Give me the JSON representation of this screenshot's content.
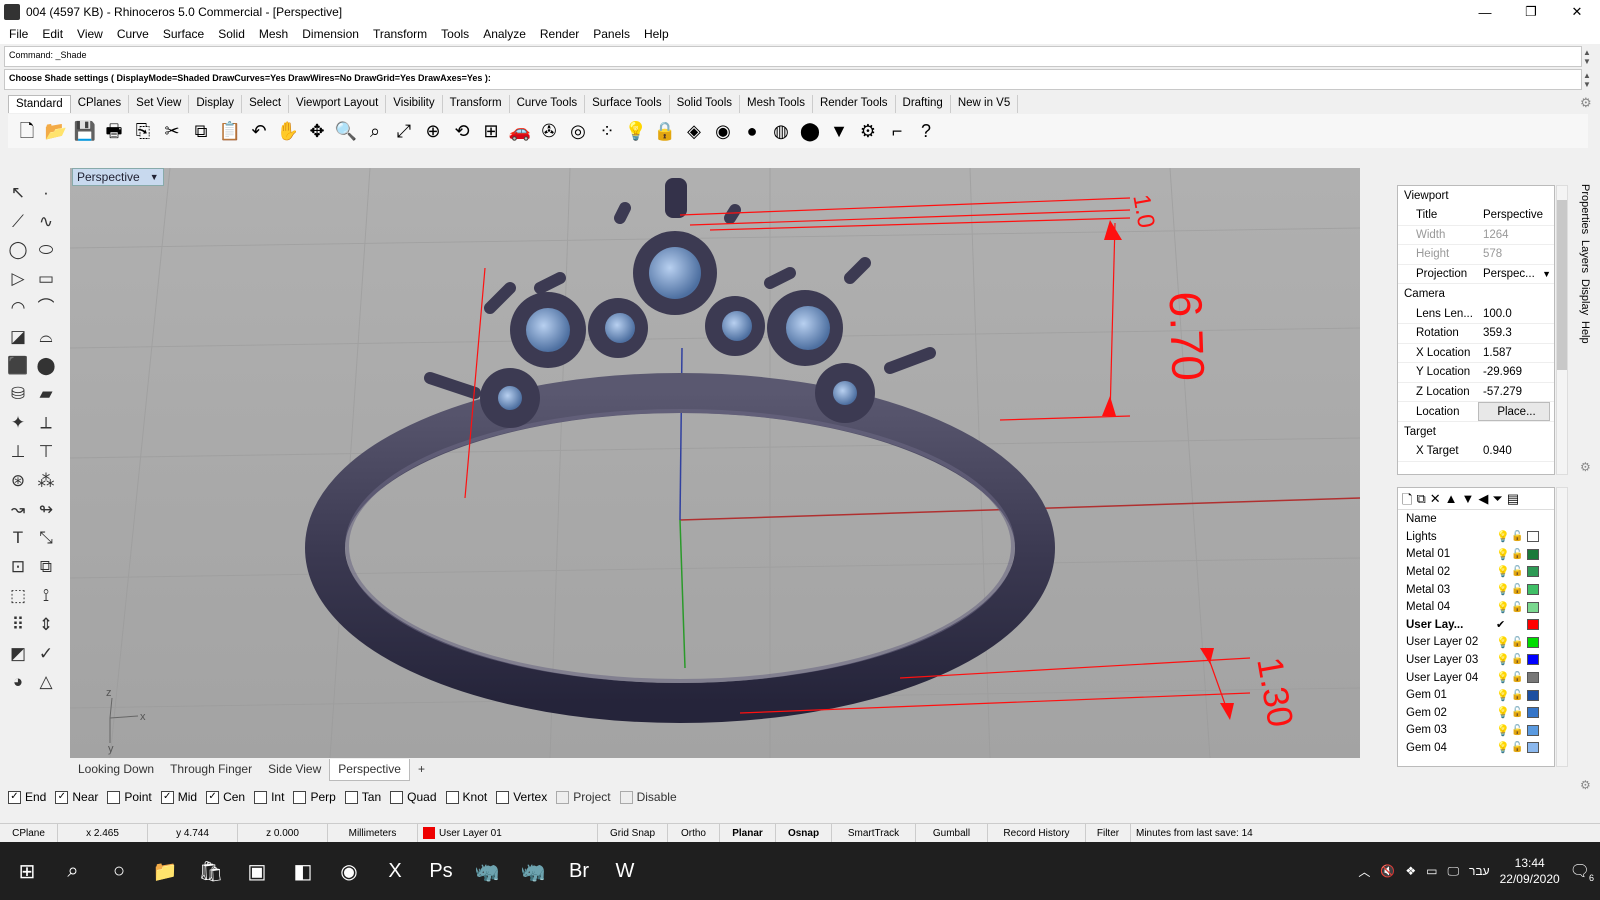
{
  "window": {
    "title": "004 (4597 KB) - Rhinoceros 5.0 Commercial - [Perspective]",
    "minimize": "—",
    "restore": "❐",
    "close": "✕"
  },
  "menu": [
    "File",
    "Edit",
    "View",
    "Curve",
    "Surface",
    "Solid",
    "Mesh",
    "Dimension",
    "Transform",
    "Tools",
    "Analyze",
    "Render",
    "Panels",
    "Help"
  ],
  "command": {
    "history": "Command: _Shade",
    "prompt": "Choose Shade settings ( DisplayMode=Shaded  DrawCurves=Yes  DrawWires=No  DrawGrid=Yes  DrawAxes=Yes ):"
  },
  "toolbar_tabs": [
    "Standard",
    "CPlanes",
    "Set View",
    "Display",
    "Select",
    "Viewport Layout",
    "Visibility",
    "Transform",
    "Curve Tools",
    "Surface Tools",
    "Solid Tools",
    "Mesh Tools",
    "Render Tools",
    "Drafting",
    "New in V5"
  ],
  "toolbar_icons": [
    {
      "name": "new-icon",
      "glyph": "🗋"
    },
    {
      "name": "open-icon",
      "glyph": "📂"
    },
    {
      "name": "save-icon",
      "glyph": "💾"
    },
    {
      "name": "print-icon",
      "glyph": "🖶"
    },
    {
      "name": "import-icon",
      "glyph": "⎘"
    },
    {
      "name": "cut-icon",
      "glyph": "✂"
    },
    {
      "name": "copy-icon",
      "glyph": "⧉"
    },
    {
      "name": "paste-icon",
      "glyph": "📋"
    },
    {
      "name": "undo-icon",
      "glyph": "↶"
    },
    {
      "name": "pan-icon",
      "glyph": "✋"
    },
    {
      "name": "move-view-icon",
      "glyph": "✥"
    },
    {
      "name": "zoom-icon",
      "glyph": "🔍"
    },
    {
      "name": "zoom-window-icon",
      "glyph": "⌕"
    },
    {
      "name": "zoom-extents-icon",
      "glyph": "⤢"
    },
    {
      "name": "zoom-selected-icon",
      "glyph": "⊕"
    },
    {
      "name": "rotate-view-icon",
      "glyph": "⟲"
    },
    {
      "name": "viewport-layout-icon",
      "glyph": "⊞"
    },
    {
      "name": "car-icon",
      "glyph": "🚗"
    },
    {
      "name": "gumball-icon",
      "glyph": "✇"
    },
    {
      "name": "circle-select-icon",
      "glyph": "◎"
    },
    {
      "name": "points-icon",
      "glyph": "⁘"
    },
    {
      "name": "light-icon",
      "glyph": "💡"
    },
    {
      "name": "lock-icon",
      "glyph": "🔒"
    },
    {
      "name": "layer-icon",
      "glyph": "◈"
    },
    {
      "name": "color-wheel-icon",
      "glyph": "◉"
    },
    {
      "name": "shade-sphere-icon",
      "glyph": "●"
    },
    {
      "name": "render-sphere-icon",
      "glyph": "◍"
    },
    {
      "name": "render-blue-sphere-icon",
      "glyph": "⬤"
    },
    {
      "name": "filter-icon",
      "glyph": "▼"
    },
    {
      "name": "options-gear-icon",
      "glyph": "⚙"
    },
    {
      "name": "snap-icon",
      "glyph": "⌐"
    },
    {
      "name": "help-icon",
      "glyph": "?"
    }
  ],
  "left_tools": [
    {
      "name": "select-icon",
      "glyph": "↖"
    },
    {
      "name": "point-icon",
      "glyph": "·"
    },
    {
      "name": "polyline-icon",
      "glyph": "⟋"
    },
    {
      "name": "curve-icon",
      "glyph": "∿"
    },
    {
      "name": "circle-icon",
      "glyph": "◯"
    },
    {
      "name": "ellipse-icon",
      "glyph": "⬭"
    },
    {
      "name": "polygon-icon",
      "glyph": "▷"
    },
    {
      "name": "rectangle-icon",
      "glyph": "▭"
    },
    {
      "name": "arc-icon",
      "glyph": "◠"
    },
    {
      "name": "fillet-icon",
      "glyph": "⌒"
    },
    {
      "name": "surface-icon",
      "glyph": "◪"
    },
    {
      "name": "loft-icon",
      "glyph": "⌓"
    },
    {
      "name": "box-icon",
      "glyph": "⬛"
    },
    {
      "name": "boolean-icon",
      "glyph": "⬤"
    },
    {
      "name": "cylinder-icon",
      "glyph": "⛁"
    },
    {
      "name": "extrude-icon",
      "glyph": "▰"
    },
    {
      "name": "solid-tools-icon",
      "glyph": "✦"
    },
    {
      "name": "dimension-icon",
      "glyph": "⟂"
    },
    {
      "name": "split-icon",
      "glyph": "⊥"
    },
    {
      "name": "trim-icon",
      "glyph": "⊤"
    },
    {
      "name": "explode-icon",
      "glyph": "⊛"
    },
    {
      "name": "group-icon",
      "glyph": "⁂"
    },
    {
      "name": "curve-edit-icon",
      "glyph": "↝"
    },
    {
      "name": "offset-icon",
      "glyph": "↬"
    },
    {
      "name": "text-icon",
      "glyph": "T"
    },
    {
      "name": "scale-icon",
      "glyph": "⤡"
    },
    {
      "name": "array-icon",
      "glyph": "⊡"
    },
    {
      "name": "mirror-icon",
      "glyph": "⧉"
    },
    {
      "name": "block-icon",
      "glyph": "⬚"
    },
    {
      "name": "analyze-icon",
      "glyph": "⟟"
    },
    {
      "name": "grid-array-icon",
      "glyph": "⠿"
    },
    {
      "name": "measure-icon",
      "glyph": "⇕"
    },
    {
      "name": "material-icon",
      "glyph": "◩"
    },
    {
      "name": "check-icon",
      "glyph": "✓"
    },
    {
      "name": "render-icon",
      "glyph": "◕"
    },
    {
      "name": "light-bulb-icon",
      "glyph": "△"
    }
  ],
  "viewport": {
    "title": "Perspective",
    "dimensions": {
      "top_gap": "1.0",
      "height": "6.70",
      "band": "1.30"
    },
    "axis_x": "x",
    "axis_y": "y",
    "axis_z": "z",
    "colors": {
      "dimension": "#ff1010",
      "metal": "#3c3a52",
      "gem": "#7a9cc9"
    }
  },
  "viewport_tabs": [
    "Looking Down",
    "Through Finger",
    "Side View",
    "Perspective"
  ],
  "add_tab": "+",
  "osnap": [
    {
      "label": "End",
      "checked": true
    },
    {
      "label": "Near",
      "checked": true
    },
    {
      "label": "Point",
      "checked": false
    },
    {
      "label": "Mid",
      "checked": true
    },
    {
      "label": "Cen",
      "checked": true
    },
    {
      "label": "Int",
      "checked": false
    },
    {
      "label": "Perp",
      "checked": false
    },
    {
      "label": "Tan",
      "checked": false
    },
    {
      "label": "Quad",
      "checked": false
    },
    {
      "label": "Knot",
      "checked": false
    },
    {
      "label": "Vertex",
      "checked": false
    },
    {
      "label": "Project",
      "checked": false,
      "disabled": true
    },
    {
      "label": "Disable",
      "checked": false,
      "disabled": true
    }
  ],
  "properties": {
    "section_viewport": "Viewport",
    "title_label": "Title",
    "title_value": "Perspective",
    "width_label": "Width",
    "width_value": "1264",
    "height_label": "Height",
    "height_value": "578",
    "projection_label": "Projection",
    "projection_value": "Perspec...",
    "section_camera": "Camera",
    "lens_label": "Lens Len...",
    "lens_value": "100.0",
    "rotation_label": "Rotation",
    "rotation_value": "359.3",
    "xloc_label": "X Location",
    "xloc_value": "1.587",
    "yloc_label": "Y Location",
    "yloc_value": "-29.969",
    "zloc_label": "Z Location",
    "zloc_value": "-57.279",
    "location_label": "Location",
    "location_button": "Place...",
    "section_target": "Target",
    "xtarget_label": "X Target",
    "xtarget_value": "0.940"
  },
  "right_tabs": [
    "Properties",
    "Layers",
    "Display",
    "Help"
  ],
  "layers": {
    "header": "Name",
    "items": [
      {
        "name": "Lights",
        "color": "#ffffff",
        "current": false
      },
      {
        "name": "Metal 01",
        "color": "#1a7a3a",
        "current": false
      },
      {
        "name": "Metal 02",
        "color": "#2e9a55",
        "current": false
      },
      {
        "name": "Metal 03",
        "color": "#3fbf66",
        "current": false
      },
      {
        "name": "Metal 04",
        "color": "#7ad88f",
        "current": false
      },
      {
        "name": "User Lay...",
        "color": "#ff0000",
        "current": true
      },
      {
        "name": "User Layer 02",
        "color": "#00dd00",
        "current": false
      },
      {
        "name": "User Layer 03",
        "color": "#0000ff",
        "current": false
      },
      {
        "name": "User Layer 04",
        "color": "#777777",
        "current": false
      },
      {
        "name": "Gem 01",
        "color": "#1d4fa0",
        "current": false
      },
      {
        "name": "Gem 02",
        "color": "#3575c8",
        "current": false
      },
      {
        "name": "Gem 03",
        "color": "#5a9ae0",
        "current": false
      },
      {
        "name": "Gem 04",
        "color": "#8bb8ee",
        "current": false
      }
    ]
  },
  "status": {
    "cplane": "CPlane",
    "x": "x 2.465",
    "y": "y 4.744",
    "z": "z 0.000",
    "units": "Millimeters",
    "layer": "User Layer 01",
    "grid_snap": "Grid Snap",
    "ortho": "Ortho",
    "planar": "Planar",
    "osnap": "Osnap",
    "smarttrack": "SmartTrack",
    "gumball": "Gumball",
    "record_history": "Record History",
    "filter": "Filter",
    "minutes": "Minutes from last save: 14"
  },
  "taskbar": {
    "apps": [
      {
        "name": "start-icon",
        "glyph": "⊞"
      },
      {
        "name": "search-icon",
        "glyph": "⌕"
      },
      {
        "name": "cortana-icon",
        "glyph": "○"
      },
      {
        "name": "file-explorer-icon",
        "glyph": "📁"
      },
      {
        "name": "store-icon",
        "glyph": "🛍"
      },
      {
        "name": "app-icon",
        "glyph": "▣"
      },
      {
        "name": "app2-icon",
        "glyph": "◧"
      },
      {
        "name": "chrome-icon",
        "glyph": "◉"
      },
      {
        "name": "excel-icon",
        "glyph": "X"
      },
      {
        "name": "photoshop-icon",
        "glyph": "Ps"
      },
      {
        "name": "rhino-icon",
        "glyph": "🦏"
      },
      {
        "name": "rhino2-icon",
        "glyph": "🦏"
      },
      {
        "name": "bridge-icon",
        "glyph": "Br"
      },
      {
        "name": "word-icon",
        "glyph": "W"
      }
    ],
    "lang": "עבר",
    "time": "13:44",
    "date": "22/09/2020",
    "notifications": "6"
  }
}
